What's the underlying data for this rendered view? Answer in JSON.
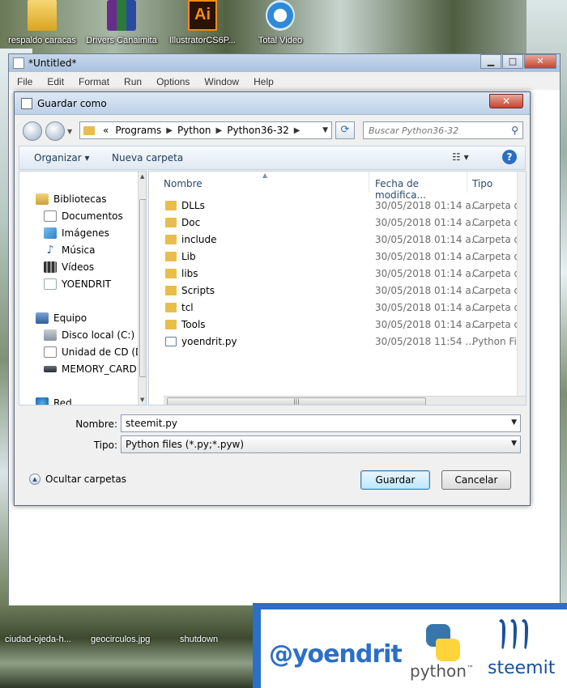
{
  "desktop": {
    "icons": [
      {
        "label": "respaldo caracas",
        "icon": "folder-icon"
      },
      {
        "label": "Drivers Canaimita",
        "icon": "winrar-icon"
      },
      {
        "label": "IllustratorCS6P...",
        "icon": "illustrator-icon"
      },
      {
        "label": "Total Video",
        "icon": "total-video-icon"
      }
    ],
    "illustrator_glyph": "Ai"
  },
  "idle_window": {
    "title": "*Untitled*",
    "menu": [
      "File",
      "Edit",
      "Format",
      "Run",
      "Options",
      "Window",
      "Help"
    ]
  },
  "dialog": {
    "title": "Guardar como",
    "breadcrumb": [
      "Programs",
      "Python",
      "Python36-32"
    ],
    "breadcrumb_prefix": "«",
    "search_placeholder": "Buscar Python36-32",
    "toolbar": {
      "organize": "Organizar ▾",
      "new_folder": "Nueva carpeta"
    },
    "nav_tree": [
      {
        "label": "Bibliotecas",
        "icon": "library-icon",
        "level": 0
      },
      {
        "label": "Documentos",
        "icon": "documents-icon",
        "level": 1
      },
      {
        "label": "Imágenes",
        "icon": "pictures-icon",
        "level": 1
      },
      {
        "label": "Música",
        "icon": "music-icon",
        "level": 1
      },
      {
        "label": "Vídeos",
        "icon": "videos-icon",
        "level": 1
      },
      {
        "label": "YOENDRIT",
        "icon": "user-folder-icon",
        "level": 1
      },
      {
        "label": "Equipo",
        "icon": "computer-icon",
        "level": 0
      },
      {
        "label": "Disco local (C:)",
        "icon": "local-disk-icon",
        "level": 1
      },
      {
        "label": "Unidad de CD (D:",
        "icon": "cd-drive-icon",
        "level": 1
      },
      {
        "label": "MEMORY_CARD",
        "icon": "usb-drive-icon",
        "level": 1
      },
      {
        "label": "Red",
        "icon": "network-icon",
        "level": 0
      }
    ],
    "columns": [
      "Nombre",
      "Fecha de modifica...",
      "Tipo"
    ],
    "files": [
      {
        "name": "DLLs",
        "date": "30/05/2018 01:14 a...",
        "type": "Carpeta de a",
        "kind": "folder"
      },
      {
        "name": "Doc",
        "date": "30/05/2018 01:14 a...",
        "type": "Carpeta de a",
        "kind": "folder"
      },
      {
        "name": "include",
        "date": "30/05/2018 01:14 a...",
        "type": "Carpeta de a",
        "kind": "folder"
      },
      {
        "name": "Lib",
        "date": "30/05/2018 01:14 a...",
        "type": "Carpeta de a",
        "kind": "folder"
      },
      {
        "name": "libs",
        "date": "30/05/2018 01:14 a...",
        "type": "Carpeta de a",
        "kind": "folder"
      },
      {
        "name": "Scripts",
        "date": "30/05/2018 01:14 a...",
        "type": "Carpeta de a",
        "kind": "folder"
      },
      {
        "name": "tcl",
        "date": "30/05/2018 01:14 a...",
        "type": "Carpeta de a",
        "kind": "folder"
      },
      {
        "name": "Tools",
        "date": "30/05/2018 01:14 a...",
        "type": "Carpeta de a",
        "kind": "folder"
      },
      {
        "name": "yoendrit.py",
        "date": "30/05/2018 11:54 ...",
        "type": "Python File",
        "kind": "python"
      }
    ],
    "filename_label": "Nombre:",
    "filename_value": "steemit.py",
    "filetype_label": "Tipo:",
    "filetype_value": "Python files (*.py;*.pyw)",
    "hide_folders": "Ocultar carpetas",
    "save_button": "Guardar",
    "cancel_button": "Cancelar"
  },
  "taskbar": {
    "items": [
      "ciudad-ojeda-h...",
      "geocirculos.jpg",
      "shutdown"
    ]
  },
  "branding": {
    "handle": "@yoendrit",
    "python": "python",
    "python_tm": "™",
    "steemit": "steemit"
  }
}
